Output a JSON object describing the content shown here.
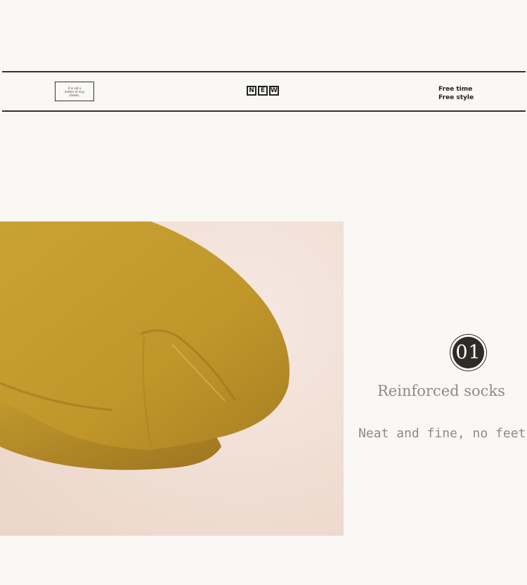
{
  "banner": {
    "badge_lines": [
      "it is not a",
      "matter of rosy",
      "cheeks."
    ],
    "new_letters": [
      "N",
      "E",
      "W"
    ],
    "free_lines": [
      "Free time",
      "Free style"
    ]
  },
  "product": {
    "image_alt": "mustard yellow sock close-up",
    "number": "01",
    "title": "Reinforced socks",
    "subtitle": "Neat and fine, no feet"
  },
  "colors": {
    "background": "#faf8f5",
    "sock": "#c49a2c",
    "badge": "#2f2c27",
    "text_gray": "#8f8a84"
  }
}
